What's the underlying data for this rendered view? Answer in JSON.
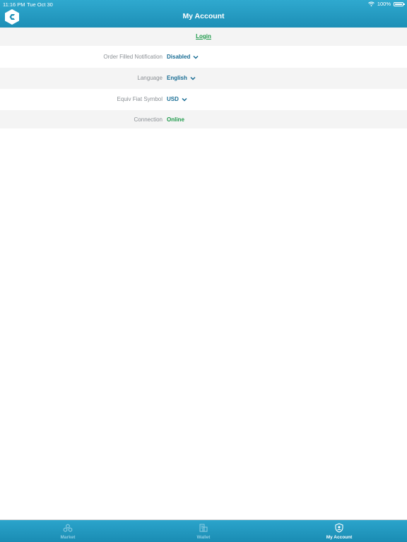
{
  "status_bar": {
    "time": "11:16 PM",
    "date": "Tue Oct 30",
    "battery": "100%"
  },
  "header": {
    "title": "My Account"
  },
  "login": {
    "label": "Login"
  },
  "settings": [
    {
      "label": "Order Filled Notification",
      "value": "Disabled",
      "dropdown": true
    },
    {
      "label": "Language",
      "value": "English",
      "dropdown": true
    },
    {
      "label": "Equiv Fiat Symbol",
      "value": "USD",
      "dropdown": true
    },
    {
      "label": "Connection",
      "value": "Online",
      "dropdown": false
    }
  ],
  "tabs": [
    {
      "label": "Market",
      "icon": "market-icon",
      "active": false
    },
    {
      "label": "Wallet",
      "icon": "wallet-icon",
      "active": false
    },
    {
      "label": "My Account",
      "icon": "account-shield-icon",
      "active": true
    }
  ],
  "colors": {
    "header": "#2fa9cf",
    "accent_blue": "#1a6e95",
    "success_green": "#1f9a4b",
    "label_gray": "#8a8f94",
    "row_alt": "#f4f4f4"
  }
}
